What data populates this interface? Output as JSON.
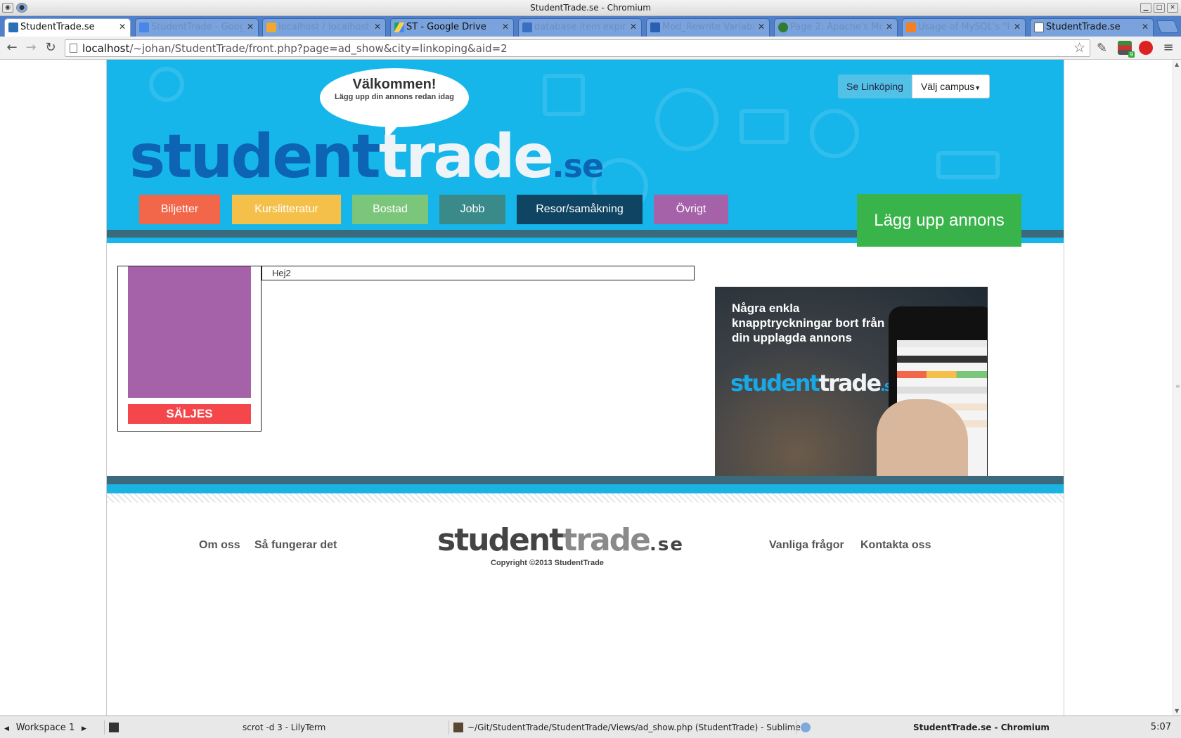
{
  "window": {
    "title": "StudentTrade.se - Chromium"
  },
  "tabs": [
    {
      "label": "StudentTrade.se",
      "active": true,
      "icon": "site-icon"
    },
    {
      "label": "StudentTrade - Googl",
      "icon": "google-docs-icon"
    },
    {
      "label": "localhost / localhost /",
      "icon": "phpmyadmin-icon"
    },
    {
      "label": "ST - Google Drive",
      "icon": "google-drive-icon"
    },
    {
      "label": "database item expire",
      "icon": "search-icon"
    },
    {
      "label": "Mod_Rewrite Variable:",
      "icon": "aa-icon"
    },
    {
      "label": "Page 2: Apache's Mod",
      "icon": "globe-icon"
    },
    {
      "label": "Usage of MySQL's \"IF",
      "icon": "stackoverflow-icon"
    },
    {
      "label": "StudentTrade.se",
      "icon": "page-icon"
    }
  ],
  "toolbar": {
    "url_host": "localhost",
    "url_path": "/~johan/StudentTrade/front.php?page=ad_show&city=linkoping&aid=2",
    "ext_badge": "9"
  },
  "site": {
    "speech_title": "Välkommen!",
    "speech_sub": "Lägg upp din annons  redan idag",
    "logo_part1": "student",
    "logo_part2": "trade",
    "logo_part3": ".se",
    "campus_city": "Se Linköping",
    "campus_pick": "Välj campus",
    "categories": [
      {
        "label": "Biljetter",
        "color": "#f26649"
      },
      {
        "label": "Kurslitteratur",
        "color": "#f4c04a"
      },
      {
        "label": "Bostad",
        "color": "#7bc67b"
      },
      {
        "label": "Jobb",
        "color": "#3b8a8a"
      },
      {
        "label": "Resor/samåkning",
        "color": "#0f4563"
      },
      {
        "label": "Övrigt",
        "color": "#a562a8"
      }
    ],
    "post_button": "Lägg upp annons",
    "ad": {
      "tag": "SÄLJES",
      "title": "Hej2",
      "image_color": "#a562a8"
    },
    "promo_text": "Några enkla knapptryckningar bort från din upplagda annons",
    "footer": {
      "links_left": [
        "Om oss",
        "Så fungerar det"
      ],
      "links_right": [
        "Vanliga frågor",
        "Kontakta oss"
      ],
      "copyright": "Copyright ©2013 StudentTrade"
    }
  },
  "taskbar": {
    "workspace": "Workspace 1",
    "tasks": [
      "scrot -d 3 - LilyTerm",
      "~/Git/StudentTrade/StudentTrade/Views/ad_show.php (StudentTrade) - Sublime",
      "StudentTrade.se - Chromium"
    ],
    "clock": "5:07"
  }
}
